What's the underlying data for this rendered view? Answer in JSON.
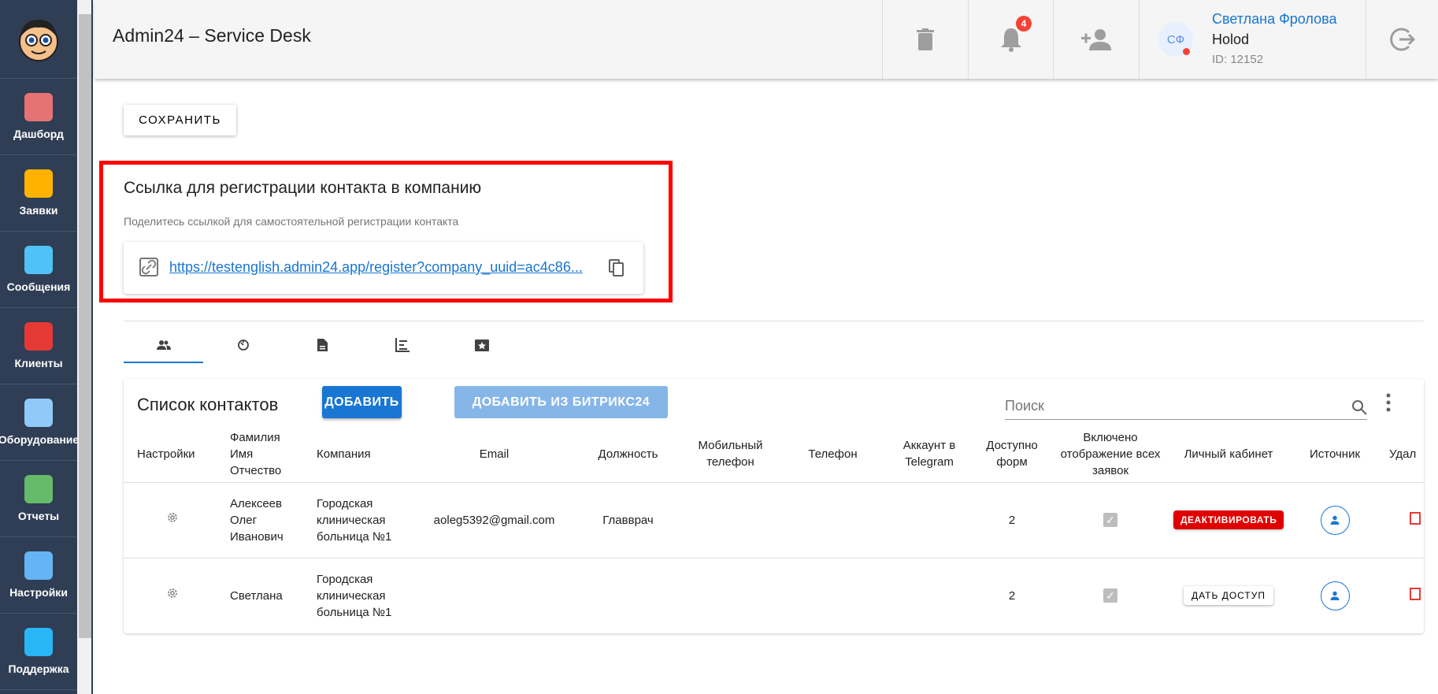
{
  "sidebar": {
    "items": [
      {
        "label": "Дашборд",
        "color": "#e57373"
      },
      {
        "label": "Заявки",
        "color": "#ffb300"
      },
      {
        "label": "Сообщения",
        "color": "#4fc3f7"
      },
      {
        "label": "Клиенты",
        "color": "#e53935"
      },
      {
        "label": "Оборудование",
        "color": "#90caf9"
      },
      {
        "label": "Отчеты",
        "color": "#66bb6a"
      },
      {
        "label": "Настройки",
        "color": "#64b5f6"
      },
      {
        "label": "Поддержка",
        "color": "#29b6f6"
      }
    ]
  },
  "header": {
    "title": "Admin24 – Service Desk",
    "notif_count": "4",
    "user": {
      "initials": "СФ",
      "name": "Светлана Фролова",
      "company": "Holod",
      "id": "ID: 12152"
    }
  },
  "save_label": "СОХРАНИТЬ",
  "register": {
    "title": "Ссылка для регистрации контакта в компанию",
    "subtitle": "Поделитесь ссылкой для самостоятельной регистрации контакта",
    "link": "https://testenglish.admin24.app/register?company_uuid=ac4c86..."
  },
  "contacts": {
    "title": "Список контактов",
    "add_label": "ДОБАВИТЬ",
    "add_bitrix_label": "ДОБАВИТЬ ИЗ БИТРИКС24",
    "search_placeholder": "Поиск",
    "columns": [
      "Настройки",
      "Фамилия Имя Отчество",
      "Компания",
      "Email",
      "Должность",
      "Мобильный телефон",
      "Телефон",
      "Аккаунт в Telegram",
      "Доступно форм",
      "Включено отображение всех заявок",
      "Личный кабинет",
      "Источник",
      "Удал"
    ],
    "rows": [
      {
        "name": "Алексеев Олег Иванович",
        "company": "Городская клиническая больница №1",
        "email": "aoleg5392@gmail.com",
        "position": "Главврач",
        "mobile": "",
        "phone": "",
        "telegram": "",
        "forms": "2",
        "show_all": true,
        "cabinet_label": "ДЕАКТИВИРОВАТЬ"
      },
      {
        "name": "Светлана",
        "company": "Городская клиническая больница №1",
        "email": "",
        "position": "",
        "mobile": "",
        "phone": "",
        "telegram": "",
        "forms": "2",
        "show_all": true,
        "cabinet_label": "ДАТЬ ДОСТУП"
      }
    ]
  }
}
